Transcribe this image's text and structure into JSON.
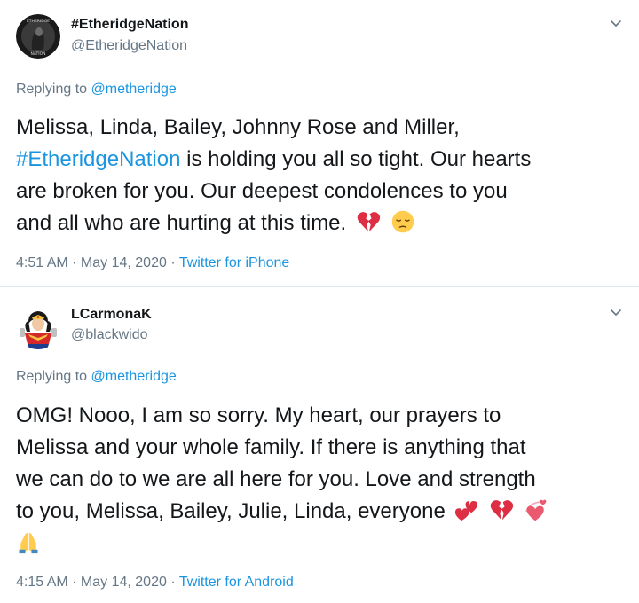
{
  "tweets": [
    {
      "display_name": "#EtheridgeNation",
      "handle": "@EtheridgeNation",
      "replying_prefix": "Replying to",
      "replying_to": "@metheridge",
      "text_line1": "Melissa, Linda, Bailey, Johnny Rose and Miller,",
      "hashtag": "#EtheridgeNation",
      "text_line2_rest": " is holding you all so tight. Our hearts",
      "text_line3": "are broken for you. Our deepest condolences to you",
      "text_line4": "and all who are hurting at this time.",
      "time": "4:51 AM",
      "separator": " · ",
      "date": "May 14, 2020",
      "source": "Twitter for iPhone"
    },
    {
      "display_name": "LCarmonaK",
      "handle": "@blackwido",
      "replying_prefix": "Replying to",
      "replying_to": "@metheridge",
      "text_line1": "OMG! Nooo, I am so sorry. My heart, our prayers to",
      "text_line2": "Melissa and your whole family. If there is anything that",
      "text_line3": "we can do to we are all here for you. Love and strength",
      "text_line4": "to you, Melissa, Bailey, Julie, Linda, everyone",
      "time": "4:15 AM",
      "separator": " · ",
      "date": "May 14, 2020",
      "source": "Twitter for Android"
    }
  ],
  "colors": {
    "link": "#1b95e0",
    "muted": "#657786",
    "text": "#14171a",
    "divider": "#e1e8ed"
  },
  "icons": [
    "avatar-etheridge-nation",
    "avatar-wonder-woman",
    "chevron-down-icon",
    "broken-heart-emoji",
    "pensive-face-emoji",
    "two-hearts-emoji",
    "revolving-hearts-emoji",
    "folded-hands-emoji"
  ]
}
